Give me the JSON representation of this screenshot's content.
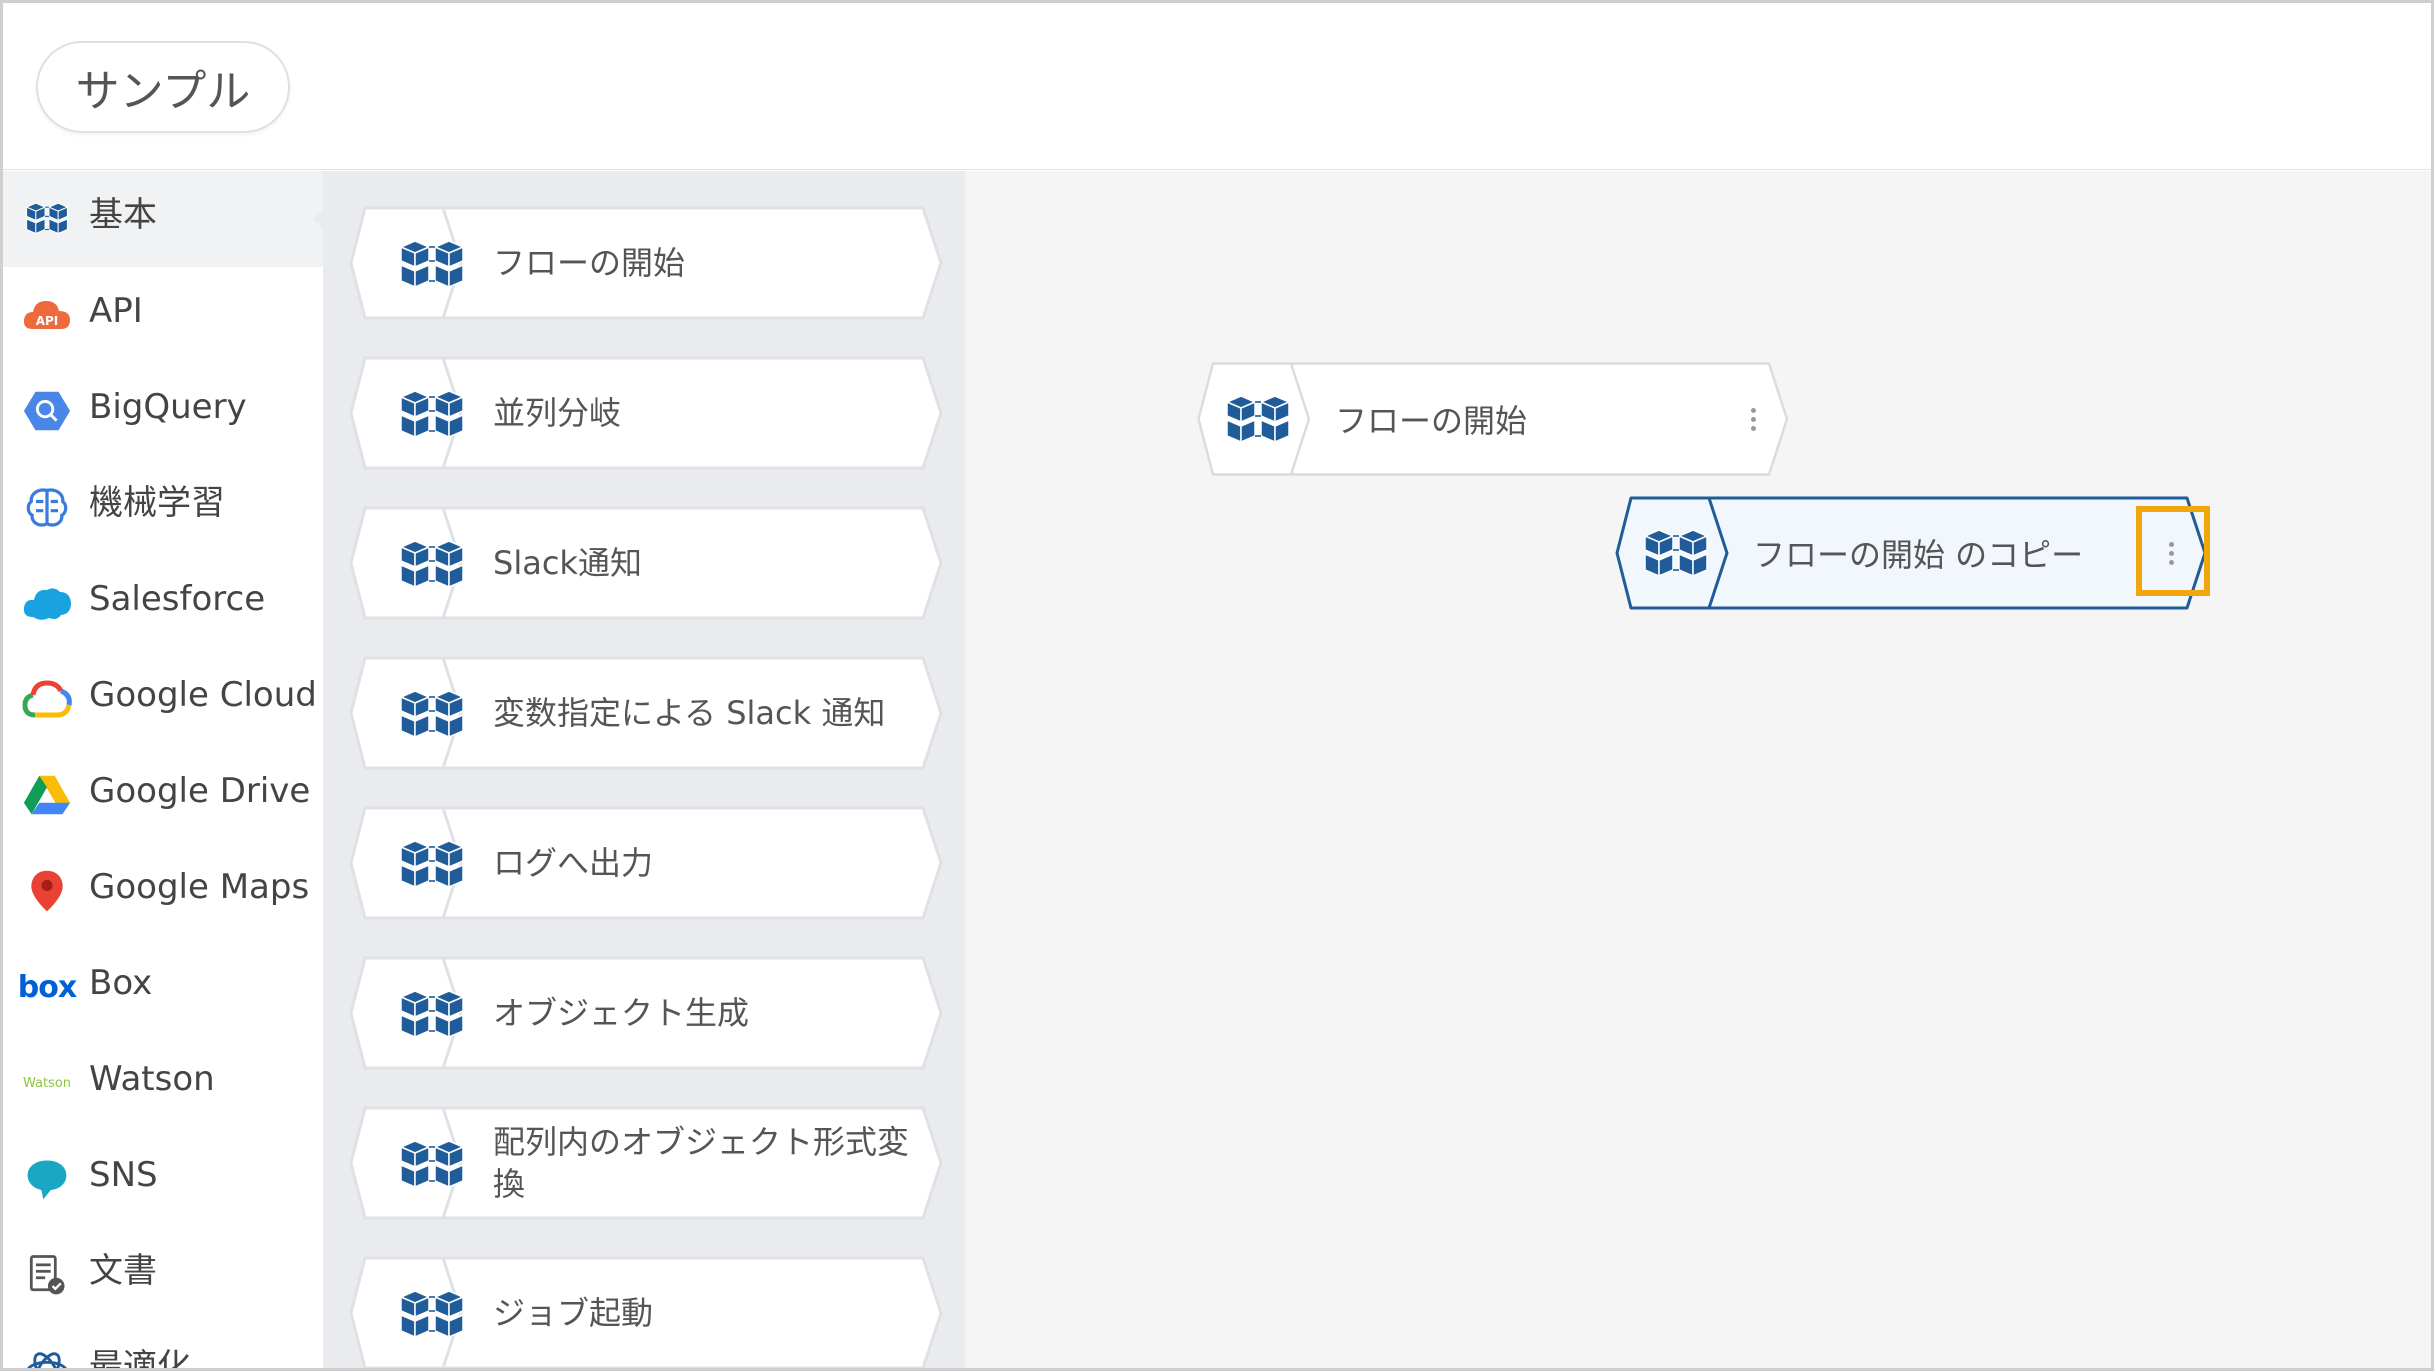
{
  "header": {
    "title": "サンプル"
  },
  "sidebar": {
    "items": [
      {
        "label": "基本",
        "icon": "cube-grid-icon",
        "active": true
      },
      {
        "label": "API",
        "icon": "api-cloud-icon"
      },
      {
        "label": "BigQuery",
        "icon": "bigquery-icon"
      },
      {
        "label": "機械学習",
        "icon": "brain-icon"
      },
      {
        "label": "Salesforce",
        "icon": "salesforce-cloud-icon"
      },
      {
        "label": "Google Cloud",
        "icon": "google-cloud-icon"
      },
      {
        "label": "Google Drive",
        "icon": "google-drive-icon"
      },
      {
        "label": "Google Maps",
        "icon": "map-pin-icon"
      },
      {
        "label": "Box",
        "icon": "box-logo-icon",
        "logo_text": "box"
      },
      {
        "label": "Watson",
        "icon": "watson-logo-icon",
        "logo_text": "Watson"
      },
      {
        "label": "SNS",
        "icon": "chat-bubble-icon"
      },
      {
        "label": "文書",
        "icon": "document-icon"
      },
      {
        "label": "最適化",
        "icon": "optimization-icon"
      }
    ]
  },
  "palette": {
    "blocks": [
      {
        "label": "フローの開始"
      },
      {
        "label": "並列分岐"
      },
      {
        "label": "Slack通知"
      },
      {
        "label": "変数指定による Slack 通知"
      },
      {
        "label": "ログへ出力"
      },
      {
        "label": "オブジェクト生成"
      },
      {
        "label": "配列内のオブジェクト形式変換"
      },
      {
        "label": "ジョブ起動"
      }
    ]
  },
  "canvas": {
    "nodes": [
      {
        "label": "フローの開始",
        "selected": false
      },
      {
        "label": "フローの開始 のコピー",
        "selected": true
      }
    ]
  },
  "colors": {
    "brand_blue": "#1f5c99",
    "highlight": "#f2a60d",
    "palette_bg": "#e9ebee",
    "canvas_bg": "#f5f5f5"
  }
}
